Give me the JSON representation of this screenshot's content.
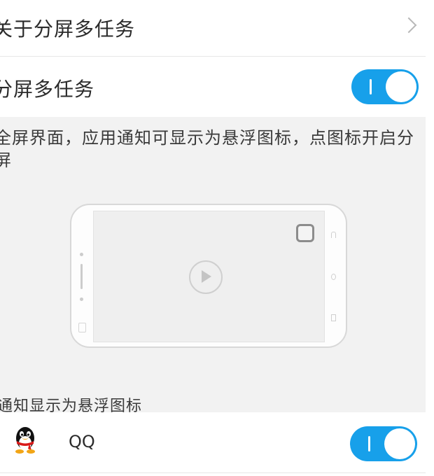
{
  "about": {
    "label": "关于分屏多任务",
    "chevron_icon": "chevron-right-icon"
  },
  "splitscreen": {
    "label": "分屏多任务",
    "toggle_on": true,
    "accent_color": "#17a0ea"
  },
  "description": "全屏界面，应用通知可显示为悬浮图标，点图标开启分屏",
  "illustration": {
    "icons": [
      "phone-landscape-icon",
      "play-icon",
      "floating-notification-icon"
    ]
  },
  "section_label": "通知显示为悬浮图标",
  "apps": [
    {
      "name": "QQ",
      "icon": "qq-penguin-icon",
      "toggle_on": true
    }
  ]
}
